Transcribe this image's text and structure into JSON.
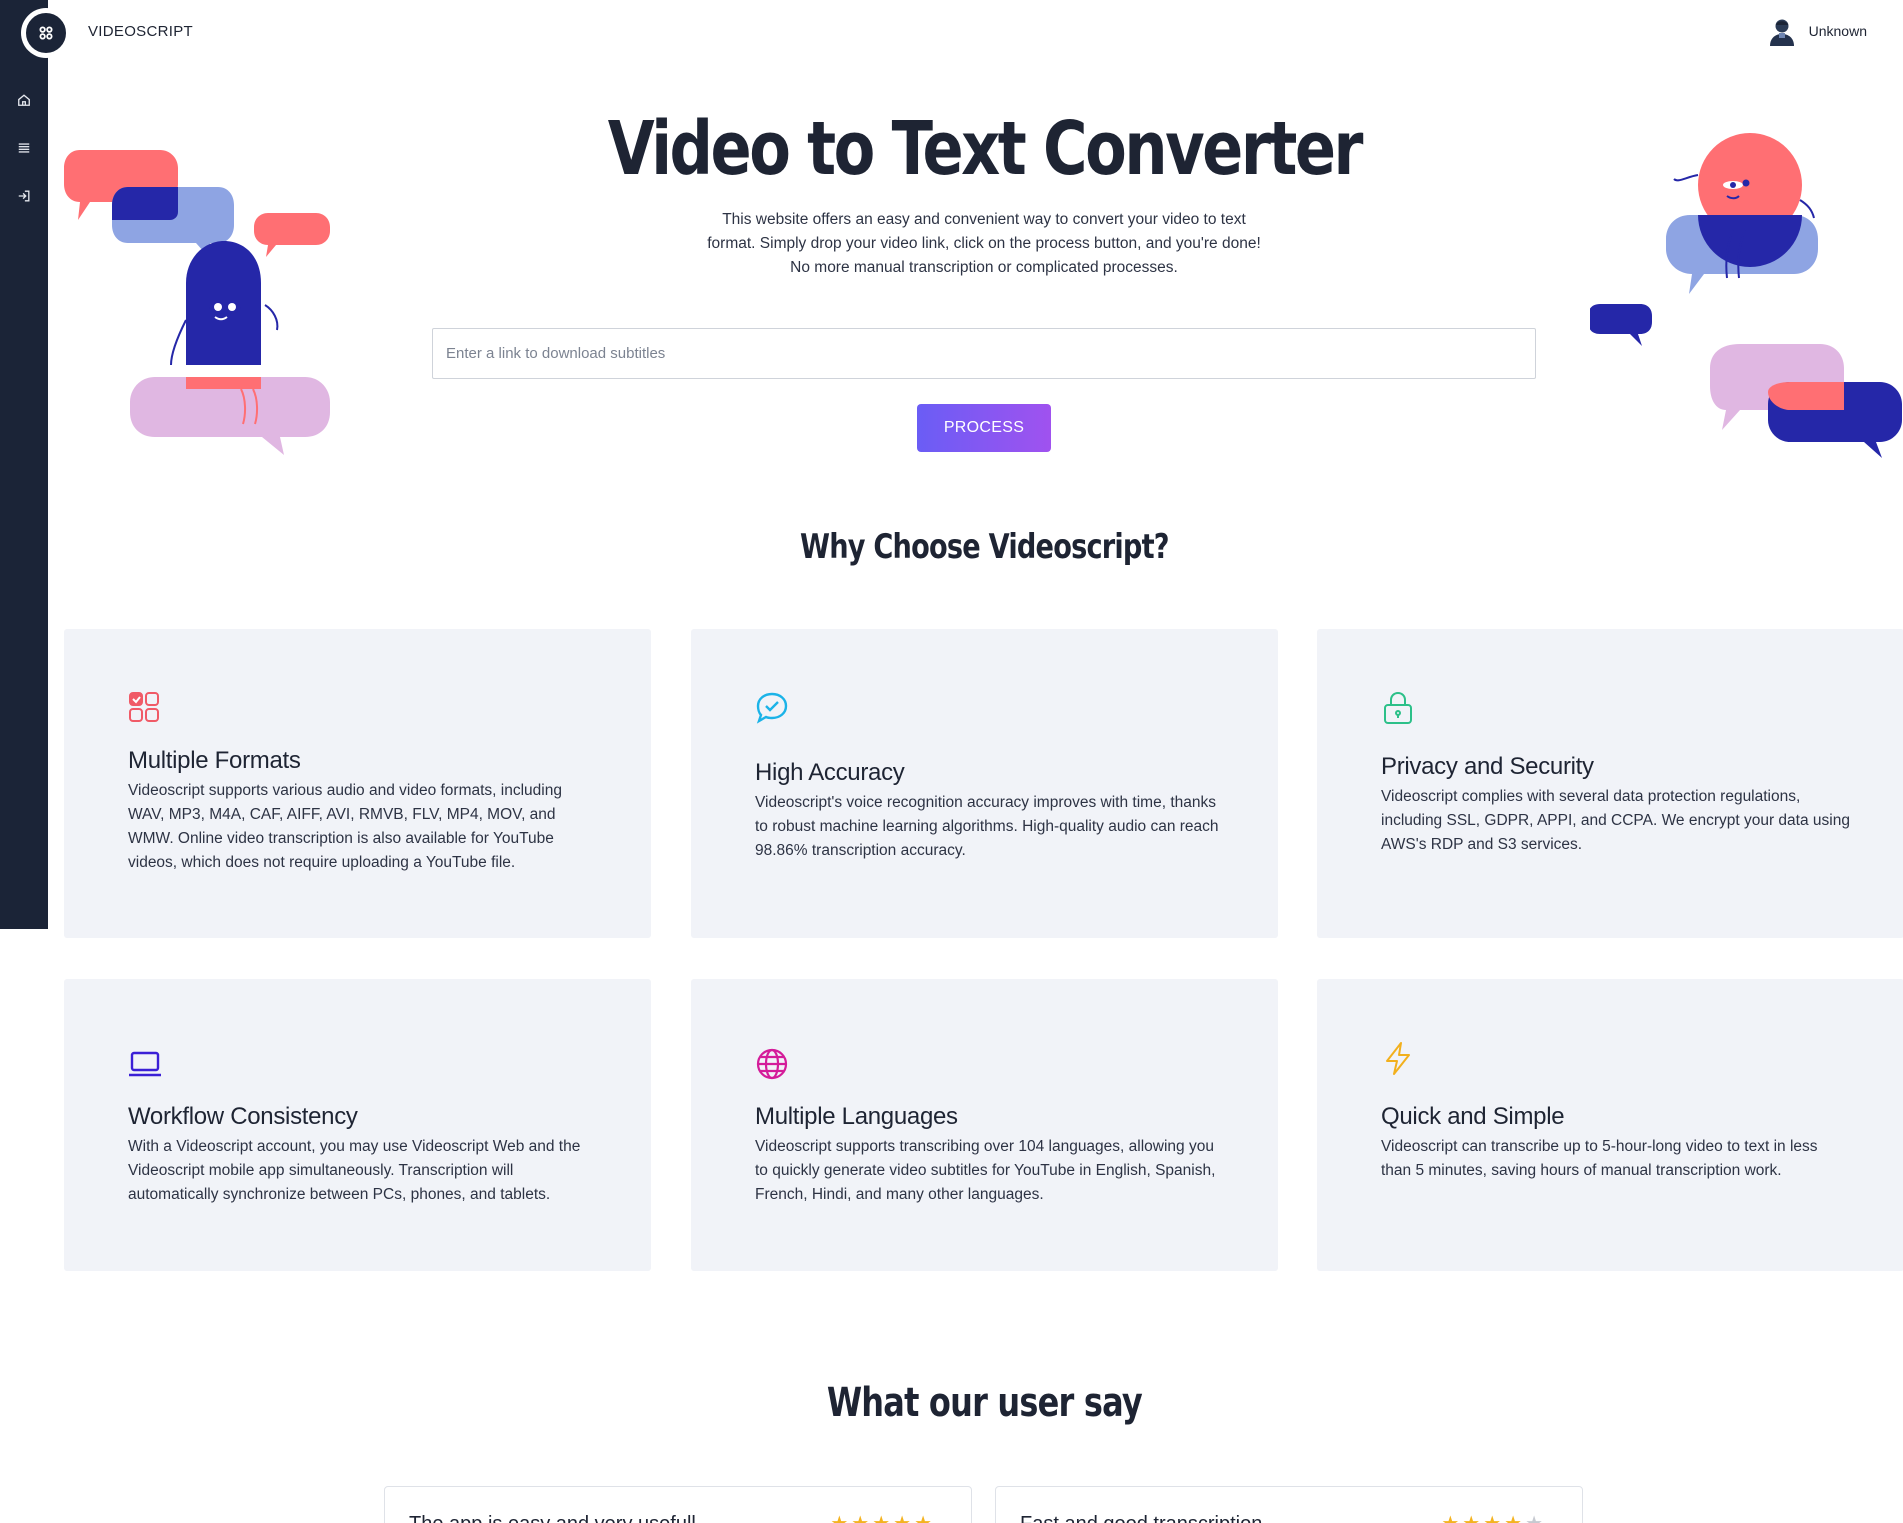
{
  "app": {
    "brand": "VIDEOSCRIPT"
  },
  "user": {
    "name": "Unknown"
  },
  "sidebar": {
    "items": [
      {
        "icon": "home-icon"
      },
      {
        "icon": "menu-icon"
      },
      {
        "icon": "login-icon"
      }
    ]
  },
  "hero": {
    "title": "Video to Text Converter",
    "description": "This website offers an easy and convenient way to convert your video to text format. Simply drop your video link, click on the process button, and you're done! No more manual transcription or complicated processes.",
    "search_placeholder": "Enter a link to download subtitles",
    "process_label": "PROCESS"
  },
  "why": {
    "title": "Why Choose Videoscript?",
    "cards": [
      {
        "icon": "grid-check-icon",
        "title": "Multiple Formats",
        "text": "Videoscript supports various audio and video formats, including WAV, MP3, M4A, CAF, AIFF, AVI, RMVB, FLV, MP4, MOV, and WMW. Online video transcription is also available for YouTube videos, which does not require uploading a YouTube file."
      },
      {
        "icon": "chat-check-icon",
        "title": "High Accuracy",
        "text": "Videoscript's voice recognition accuracy improves with time, thanks to robust machine learning algorithms. High-quality audio can reach 98.86% transcription accuracy."
      },
      {
        "icon": "lock-icon",
        "title": "Privacy and Security",
        "text": "Videoscript complies with several data protection regulations, including SSL, GDPR, APPI, and CCPA. We encrypt your data using AWS's RDP and S3 services."
      },
      {
        "icon": "laptop-icon",
        "title": "Workflow Consistency",
        "text": "With a Videoscript account, you may use Videoscript Web and the Videoscript mobile app simultaneously. Transcription will automatically synchronize between PCs, phones, and tablets."
      },
      {
        "icon": "globe-icon",
        "title": "Multiple Languages",
        "text": "Videoscript supports transcribing over 104 languages, allowing you to quickly generate video subtitles for YouTube in English, Spanish, French, Hindi, and many other languages."
      },
      {
        "icon": "lightning-icon",
        "title": "Quick and Simple",
        "text": "Videoscript can transcribe up to 5-hour-long video to text in less than 5 minutes, saving hours of manual transcription work."
      }
    ]
  },
  "testimonials": {
    "title": "What our user say",
    "reviews": [
      {
        "title": "The app is easy and very usefull",
        "rating": 5
      },
      {
        "title": "Fast and good transcription",
        "rating": 4
      }
    ]
  },
  "colors": {
    "sidebar": "#1b2437",
    "accent_start": "#6a5df5",
    "accent_end": "#a052ef",
    "card_bg": "#f1f3f8"
  }
}
